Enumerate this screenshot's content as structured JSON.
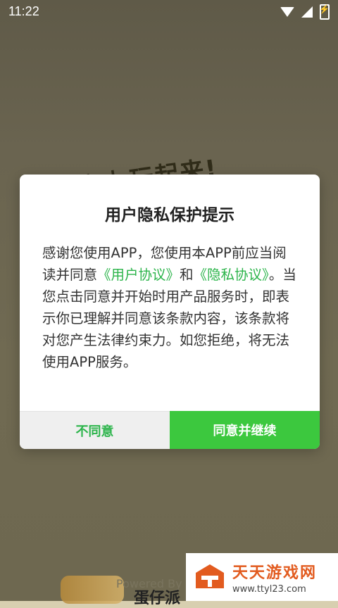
{
  "status_bar": {
    "time": "11:22"
  },
  "splash": {
    "headline": "派对 玩起来!",
    "powered": "Powered By",
    "game_name": "蛋仔派"
  },
  "dialog": {
    "title": "用户隐私保护提示",
    "body_part1": "感谢您使用APP，您使用本APP前应当阅读并同意",
    "link_user_agreement": "《用户协议》",
    "body_and": "和",
    "link_privacy": "《隐私协议》",
    "body_part2": "。当您点击同意并开始时用产品服务时，即表示你已理解并同意该条款内容，该条款将对您产生法律约束力。如您拒绝，将无法使用APP服务。",
    "disagree_label": "不同意",
    "agree_label": "同意并继续"
  },
  "watermark": {
    "name": "天天游戏网",
    "url": "www.ttyl23.com"
  },
  "colors": {
    "accent": "#3cc83e",
    "link": "#2bb44a",
    "watermark": "#e25b1f"
  }
}
